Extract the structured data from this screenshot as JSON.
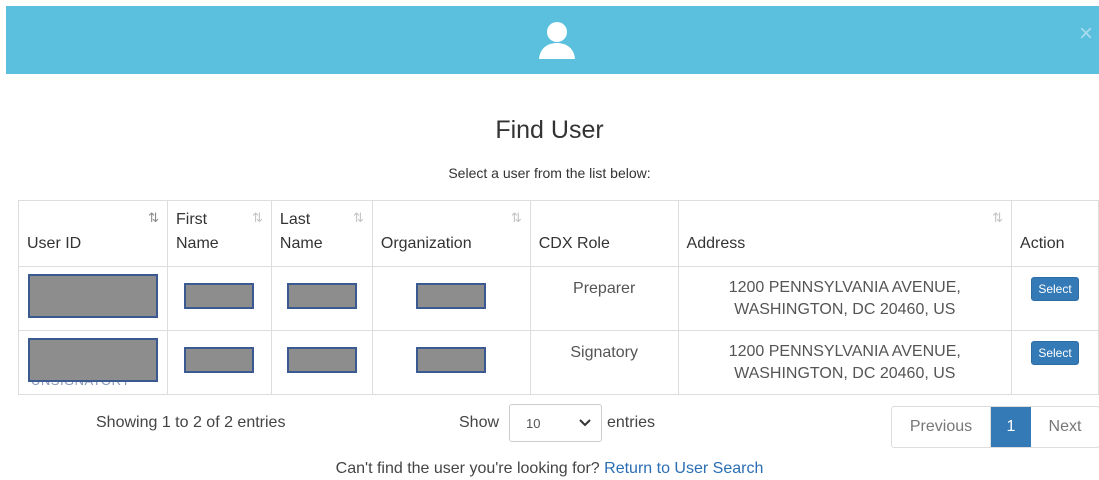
{
  "header": {
    "close_symbol": "×",
    "icon": "user-icon",
    "background": "#5bc0de"
  },
  "title": "Find User",
  "subtitle": "Select a user from the list below:",
  "table": {
    "columns": [
      "User ID",
      "First Name",
      "Last Name",
      "Organization",
      "CDX Role",
      "Address",
      "Action"
    ],
    "rows": [
      {
        "user_id": "",
        "first_name": "",
        "last_name": "",
        "organization": "",
        "cdx_role": "Preparer",
        "address_line1": "1200 PENNSYLVANIA AVENUE,",
        "address_line2": "WASHINGTON, DC 20460, US",
        "action": "Select"
      },
      {
        "user_id": "",
        "user_id_fragment": "UNSIGNATORY",
        "first_name": "",
        "last_name": "",
        "organization": "",
        "cdx_role": "Signatory",
        "address_line1": "1200 PENNSYLVANIA AVENUE,",
        "address_line2": "WASHINGTON, DC 20460, US",
        "action": "Select"
      }
    ]
  },
  "info": "Showing 1 to 2 of 2 entries",
  "length": {
    "show_label": "Show",
    "value": "10",
    "entries_label": "entries"
  },
  "pagination": {
    "previous": "Previous",
    "current": "1",
    "next": "Next"
  },
  "footer": {
    "text": "Can't find the user you're looking for?",
    "link": "Return to User Search"
  }
}
